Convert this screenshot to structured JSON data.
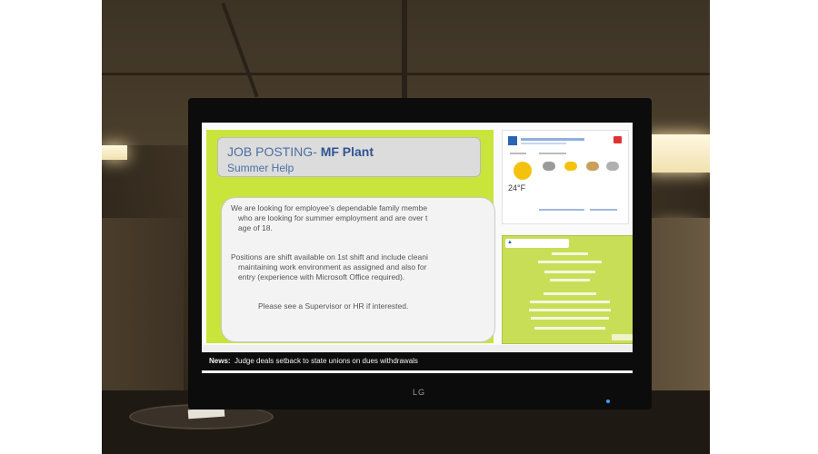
{
  "posting": {
    "title_prefix": "JOB POSTING- ",
    "title_emphasis": "MF Plant",
    "subtitle": "Summer Help",
    "paragraph1": [
      "We are looking for employee’s dependable family membe",
      "who are looking for summer employment and are over t",
      "age of 18."
    ],
    "paragraph2": [
      "Positions are shift available on 1st shift and include cleani",
      "maintaining work environment as assigned and also for",
      "entry (experience with Microsoft Office required)."
    ],
    "closing": "Please see a Supervisor or HR if interested."
  },
  "weather": {
    "temperature": "24°F",
    "colors": {
      "badge": "#2a64b5",
      "sun": "#f4c20d",
      "alert": "#dd3333"
    }
  },
  "ticker": {
    "label": "News:",
    "headline": "Judge deals setback to state unions on dues withdrawals"
  },
  "tv": {
    "brand": "LG"
  },
  "colors": {
    "panel_green": "#c9e43a",
    "title_blue": "#2f5492",
    "ticker_bg": "#0c0c0c"
  }
}
